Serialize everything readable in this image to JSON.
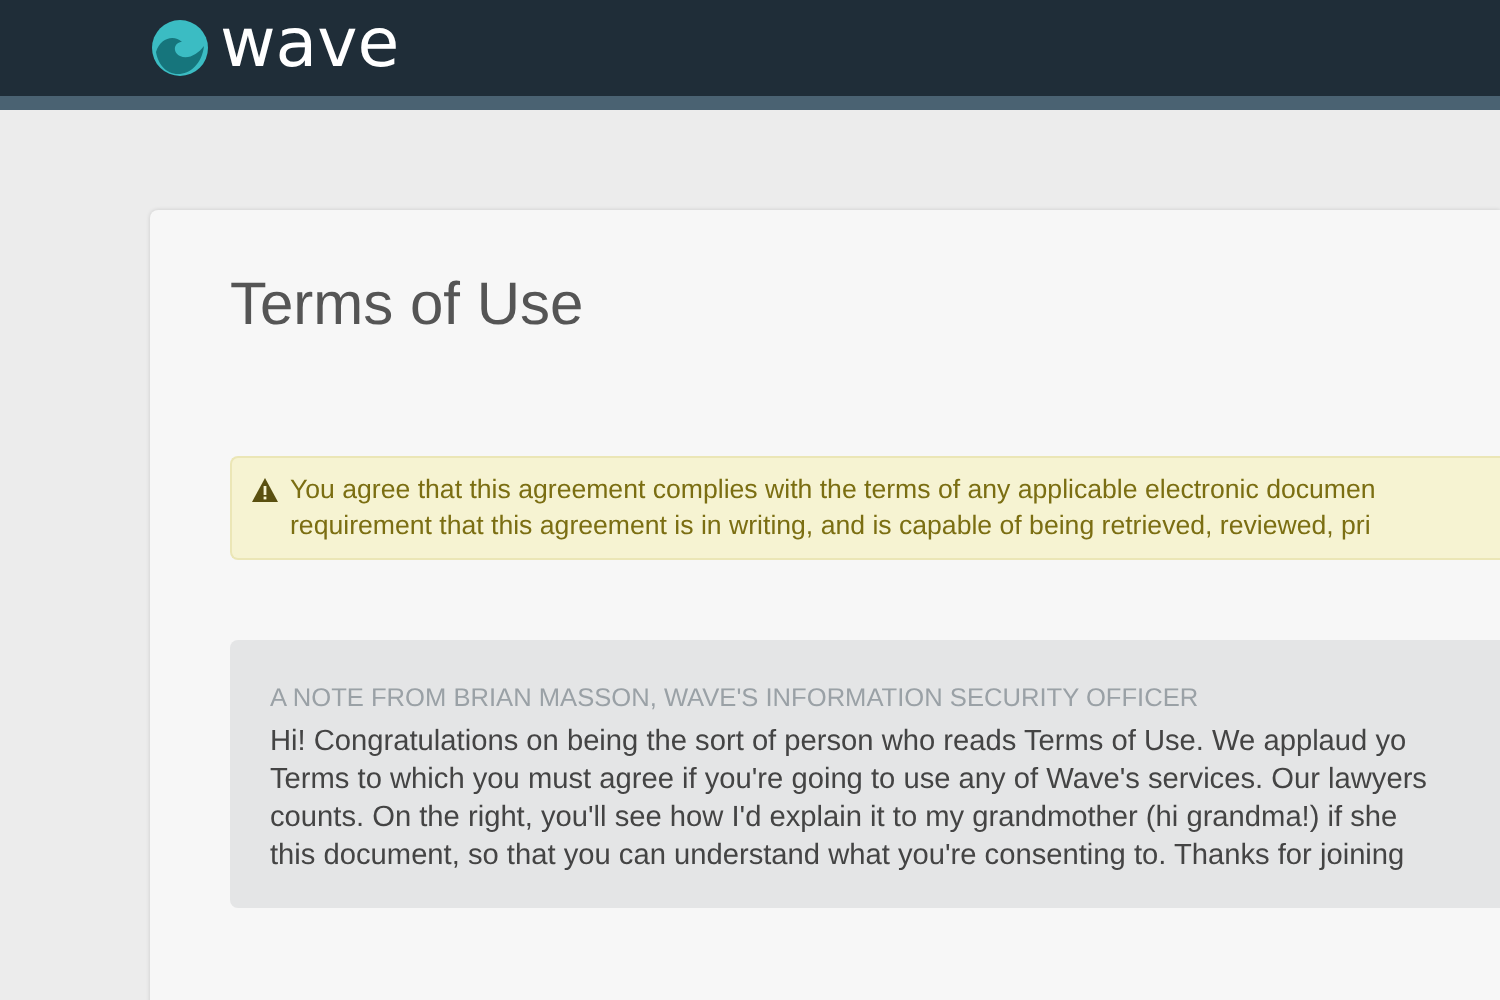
{
  "header": {
    "logo_text": "wave"
  },
  "page": {
    "title": "Terms of Use"
  },
  "alert": {
    "lines": [
      "You agree that this agreement complies with the terms of any applicable electronic documen",
      "requirement that this agreement is in writing, and is capable of being retrieved, reviewed, pri"
    ]
  },
  "note": {
    "heading": "A NOTE FROM BRIAN MASSON, WAVE'S INFORMATION SECURITY OFFICER",
    "lines": [
      "Hi! Congratulations on being the sort of person who reads Terms of Use. We applaud yo",
      "Terms to which you must agree if you're going to use any of Wave's services. Our lawyers",
      "counts. On the right, you'll see how I'd explain it to my grandmother (hi grandma!) if she",
      "this document, so that you can understand what you're consenting to. Thanks for joining"
    ]
  }
}
